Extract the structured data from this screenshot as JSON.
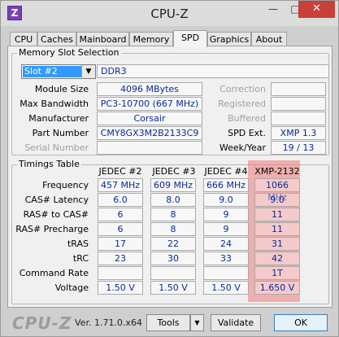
{
  "window": {
    "title": "CPU-Z",
    "icon_letter": "Z",
    "minimize": "—",
    "maximize": "□",
    "close": "✕"
  },
  "tabs": [
    "CPU",
    "Caches",
    "Mainboard",
    "Memory",
    "SPD",
    "Graphics",
    "About"
  ],
  "active_tab": "SPD",
  "memory_slot": {
    "group_label": "Memory Slot Selection",
    "slot_selected": "Slot #2",
    "memory_type": "DDR3",
    "labels": {
      "module_size": "Module Size",
      "max_bandwidth": "Max Bandwidth",
      "manufacturer": "Manufacturer",
      "part_number": "Part Number",
      "serial_number": "Serial Number",
      "correction": "Correction",
      "registered": "Registered",
      "buffered": "Buffered",
      "spd_ext": "SPD Ext.",
      "week_year": "Week/Year"
    },
    "values": {
      "module_size": "4096 MBytes",
      "max_bandwidth": "PC3-10700 (667 MHz)",
      "manufacturer": "Corsair",
      "part_number": "CMY8GX3M2B2133C9",
      "serial_number": "",
      "correction": "",
      "registered": "",
      "buffered": "",
      "spd_ext": "XMP 1.3",
      "week_year": "19 / 13"
    }
  },
  "timings": {
    "group_label": "Timings Table",
    "columns": [
      "JEDEC #2",
      "JEDEC #3",
      "JEDEC #4",
      "XMP-2132"
    ],
    "rows": [
      {
        "label": "Frequency",
        "values": [
          "457 MHz",
          "609 MHz",
          "666 MHz",
          "1066 MHz"
        ]
      },
      {
        "label": "CAS# Latency",
        "values": [
          "6.0",
          "8.0",
          "9.0",
          "9.0"
        ]
      },
      {
        "label": "RAS# to CAS#",
        "values": [
          "6",
          "8",
          "9",
          "11"
        ]
      },
      {
        "label": "RAS# Precharge",
        "values": [
          "6",
          "8",
          "9",
          "11"
        ]
      },
      {
        "label": "tRAS",
        "values": [
          "17",
          "22",
          "24",
          "31"
        ]
      },
      {
        "label": "tRC",
        "values": [
          "23",
          "30",
          "33",
          "42"
        ]
      },
      {
        "label": "Command Rate",
        "values": [
          "",
          "",
          "",
          "1T"
        ]
      },
      {
        "label": "Voltage",
        "values": [
          "1.50 V",
          "1.50 V",
          "1.50 V",
          "1.650 V"
        ]
      }
    ],
    "highlight_color": "#f07878"
  },
  "footer": {
    "brand": "CPU-Z",
    "version": "Ver. 1.71.0.x64",
    "tools": "Tools",
    "tools_arrow": "▼",
    "validate": "Validate",
    "ok": "OK"
  }
}
